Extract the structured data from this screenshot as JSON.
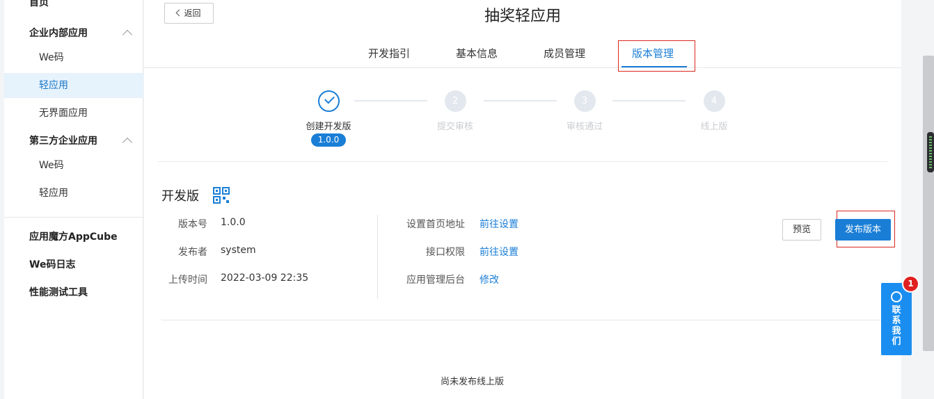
{
  "sidebar": {
    "top_item": "首页",
    "group_internal": "企业内部应用",
    "internal_items": [
      "We码",
      "轻应用",
      "无界面应用"
    ],
    "group_third_party": "第三方企业应用",
    "third_party_items": [
      "We码",
      "轻应用"
    ],
    "standalone_items": [
      "应用魔方AppCube",
      "We码日志",
      "性能测试工具"
    ]
  },
  "header": {
    "back_label": "返回",
    "title": "抽奖轻应用"
  },
  "tabs": [
    "开发指引",
    "基本信息",
    "成员管理",
    "版本管理"
  ],
  "steps": {
    "items": [
      {
        "number": "",
        "label": "创建开发版"
      },
      {
        "number": "2",
        "label": "提交审核"
      },
      {
        "number": "3",
        "label": "审核通过"
      },
      {
        "number": "4",
        "label": "线上版"
      }
    ],
    "current_version": "1.0.0"
  },
  "dev_version": {
    "title": "开发版",
    "fields": [
      {
        "label": "版本号",
        "value": "1.0.0"
      },
      {
        "label": "发布者",
        "value": "system"
      },
      {
        "label": "上传时间",
        "value": "2022-03-09 22:35"
      }
    ],
    "settings": [
      {
        "label": "设置首页地址",
        "action": "前往设置"
      },
      {
        "label": "接口权限",
        "action": "前往设置"
      },
      {
        "label": "应用管理后台",
        "action": "修改"
      }
    ],
    "preview_label": "预览",
    "publish_label": "发布版本"
  },
  "online_empty_text": "尚未发布线上版",
  "contact": {
    "label": "联系我们",
    "badge_count": "1"
  },
  "colors": {
    "accent": "#1a7ed6",
    "highlight_border": "#d9281f",
    "badge": "#e02020"
  }
}
